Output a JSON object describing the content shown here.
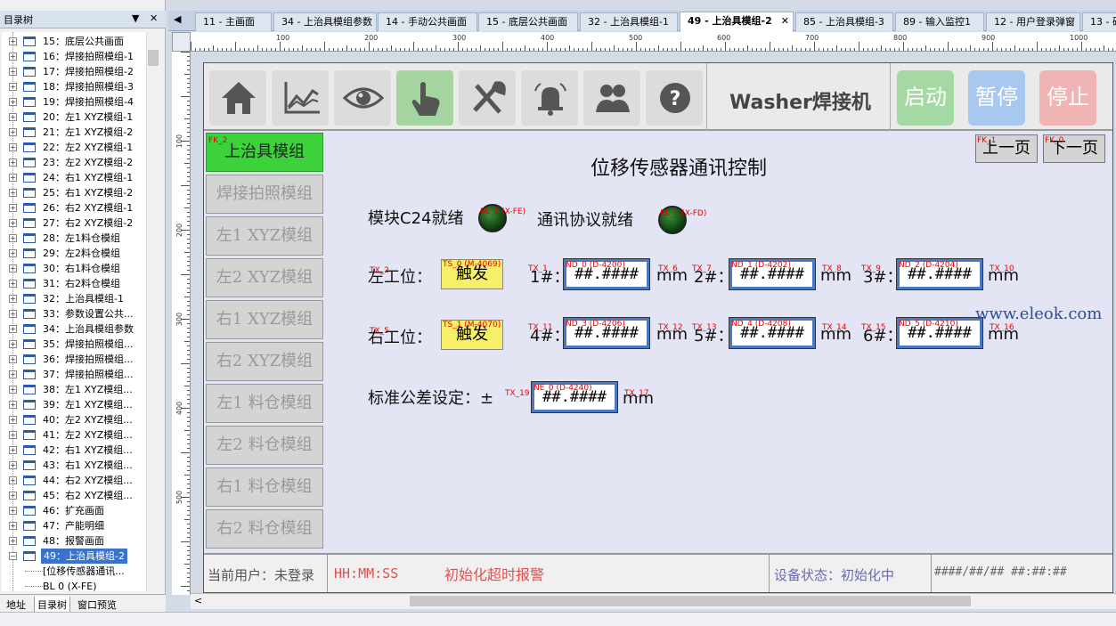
{
  "left_panel": {
    "title": "目录树",
    "pin": "▼",
    "close": "✕",
    "tree_items": [
      "15：底层公共画面",
      "16：焊接拍照模组-1",
      "17：焊接拍照模组-2",
      "18：焊接拍照模组-3",
      "19：焊接拍照模组-4",
      "20：左1 XYZ模组-1",
      "21：左1 XYZ模组-2",
      "22：左2 XYZ模组-1",
      "23：左2 XYZ模组-2",
      "24：右1 XYZ模组-1",
      "25：右1 XYZ模组-2",
      "26：右2 XYZ模组-1",
      "27：右2 XYZ模组-2",
      "28：左1料仓模组",
      "29：左2料仓模组",
      "30：右1料仓模组",
      "31：右2料仓模组",
      "32：上治具模组-1",
      "33：参数设置公共...",
      "34：上治具模组参数",
      "35：焊接拍照模组...",
      "36：焊接拍照模组...",
      "37：焊接拍照模组...",
      "38：左1 XYZ模组...",
      "39：左1 XYZ模组...",
      "40：左2 XYZ模组...",
      "41：左2 XYZ模组...",
      "42：右1 XYZ模组...",
      "43：右1 XYZ模组...",
      "44：右2 XYZ模组...",
      "45：右2 XYZ模组...",
      "46：扩充画面",
      "47：产能明细",
      "48：报警画面",
      "49：上治具模组-2"
    ],
    "sub_items": [
      "[位移传感器通讯...",
      "BL 0 (X-FE)"
    ],
    "bottom_tabs": [
      "地址",
      "目录树",
      "窗口预览"
    ]
  },
  "tabs": [
    "11 - 主画面",
    "34 - 上治具模组参数",
    "14 - 手动公共画面",
    "15 - 底层公共画面",
    "32 - 上治具模组-1",
    "49 - 上治具模组-2",
    "85 - 上治具模组-3",
    "89 - 输入监控1",
    "12 - 用户登录弹窗",
    "13 - 确"
  ],
  "tab_close": "✕",
  "tab_arrow": "◀",
  "ruler_top": [
    "100",
    "200",
    "300",
    "400",
    "500",
    "600",
    "700",
    "800",
    "900",
    "1000"
  ],
  "ruler_left": [
    "100",
    "200",
    "300",
    "400",
    "500"
  ],
  "hmi": {
    "app_title": "Washer焊接机",
    "nav_icons": [
      "home-icon",
      "trend-chart-icon",
      "eye-icon",
      "hand-pointer-icon",
      "tools-icon",
      "alarm-bell-icon",
      "users-icon",
      "help-icon"
    ],
    "start": "启动",
    "pause": "暂停",
    "stop": "停止",
    "menu": [
      "上治具模组",
      "焊接拍照模组",
      "左1 XYZ模组",
      "左2 XYZ模组",
      "右1 XYZ模组",
      "右2 XYZ模组",
      "左1 料仓模组",
      "左2 料仓模组",
      "右1 料仓模组",
      "右2 料仓模组"
    ],
    "menu_tag": "FK_2",
    "page_title": "位移传感器通讯控制",
    "prev_page": "上一页",
    "next_page": "下一页",
    "prev_tag": "FK_1",
    "next_tag": "FK_0",
    "module_ready": "模块C24就绪",
    "protocol_ready": "通讯协议就绪",
    "led1_tag": "BL_0 (X-FE)",
    "led2_tag": "BL_1 (X-FD)",
    "left_station": "左工位：",
    "right_station": "右工位：",
    "trigger": "触发",
    "trig1_tag": "TS_0 (M-4069)",
    "trig2_tag": "TS_1 (M-4070)",
    "tx2": "TX_2",
    "tx5": "TX_5",
    "row1": [
      {
        "label": "1#：",
        "tag": "ND_0 (D-4200)",
        "tx": "TX_1",
        "txu": "TX_6"
      },
      {
        "label": "2#：",
        "tag": "ND_1 (D-4202)",
        "tx": "TX_7",
        "txu": "TX_8"
      },
      {
        "label": "3#：",
        "tag": "ND_2 (D-4204)",
        "tx": "TX_9",
        "txu": "TX_10"
      }
    ],
    "row2": [
      {
        "label": "4#：",
        "tag": "ND_3 (D-4206)",
        "tx": "TX_11",
        "txu": "TX_12"
      },
      {
        "label": "5#：",
        "tag": "ND_4 (D-4208)",
        "tx": "TX_13",
        "txu": "TX_14"
      },
      {
        "label": "6#：",
        "tag": "ND_5 (D-4210)",
        "tx": "TX_15",
        "txu": "TX_16"
      }
    ],
    "num_value": "##.####",
    "unit": "mm",
    "tolerance_label": "标准公差设定：±",
    "tol_tag": "NE_0 (D-4240)",
    "tx19": "TX_19",
    "tx17": "TX_17",
    "status": {
      "user": "当前用户：未登录",
      "time": "HH:MM:SS",
      "alarm": "初始化超时报警",
      "device": "设备状态：初始化中",
      "datetime": "####/##/## ##:##:##"
    },
    "watermark": "www.eleok.com"
  },
  "colors": {
    "active_menu": "#3bd23b",
    "trigger": "#f5ef6a",
    "number_border": "#4a78c2",
    "start": "#a4d9a4",
    "pause": "#a9c8f0",
    "stop": "#f0b4b4"
  }
}
